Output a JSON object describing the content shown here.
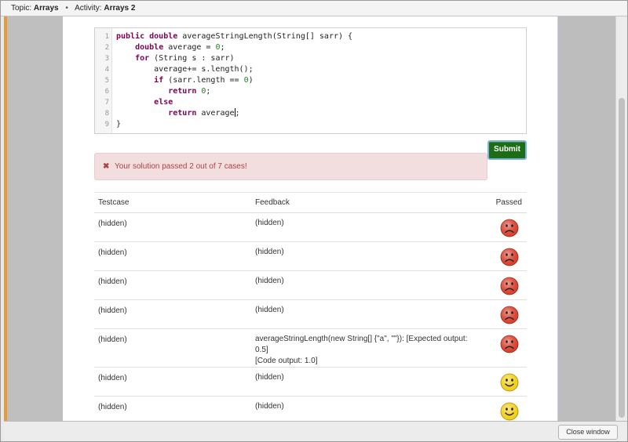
{
  "titlebar": {
    "topic_label": "Topic:",
    "topic_value": "Arrays",
    "separator": "•",
    "activity_label": "Activity:",
    "activity_value": "Arrays 2"
  },
  "editor": {
    "lines": [
      {
        "num": "1",
        "tokens": [
          {
            "t": "public double",
            "c": "kw"
          },
          {
            "t": " averageStringLength(String[] sarr) {",
            "c": ""
          }
        ]
      },
      {
        "num": "2",
        "tokens": [
          {
            "t": "    ",
            "c": ""
          },
          {
            "t": "double",
            "c": "kw"
          },
          {
            "t": " average = ",
            "c": ""
          },
          {
            "t": "0",
            "c": "num"
          },
          {
            "t": ";",
            "c": ""
          }
        ]
      },
      {
        "num": "3",
        "tokens": [
          {
            "t": "    ",
            "c": ""
          },
          {
            "t": "for",
            "c": "kw"
          },
          {
            "t": " (String s : sarr)",
            "c": ""
          }
        ]
      },
      {
        "num": "4",
        "tokens": [
          {
            "t": "        average+= s.length();",
            "c": ""
          }
        ]
      },
      {
        "num": "5",
        "tokens": [
          {
            "t": "        ",
            "c": ""
          },
          {
            "t": "if",
            "c": "kw"
          },
          {
            "t": " (sarr.length == ",
            "c": ""
          },
          {
            "t": "0",
            "c": "num"
          },
          {
            "t": ")",
            "c": ""
          }
        ]
      },
      {
        "num": "6",
        "tokens": [
          {
            "t": "           ",
            "c": ""
          },
          {
            "t": "return",
            "c": "kw"
          },
          {
            "t": " ",
            "c": ""
          },
          {
            "t": "0",
            "c": "num"
          },
          {
            "t": ";",
            "c": ""
          }
        ]
      },
      {
        "num": "7",
        "tokens": [
          {
            "t": "        ",
            "c": ""
          },
          {
            "t": "else",
            "c": "kw"
          }
        ]
      },
      {
        "num": "8",
        "tokens": [
          {
            "t": "           ",
            "c": ""
          },
          {
            "t": "return",
            "c": "kw"
          },
          {
            "t": " average",
            "c": ""
          },
          {
            "t": "",
            "c": "caret"
          },
          {
            "t": ";",
            "c": ""
          }
        ]
      },
      {
        "num": "9",
        "tokens": [
          {
            "t": "}",
            "c": ""
          }
        ]
      }
    ]
  },
  "submit_label": "Submit",
  "alert": {
    "icon": "✖",
    "message": "Your solution passed 2 out of 7 cases!"
  },
  "table": {
    "headers": {
      "testcase": "Testcase",
      "feedback": "Feedback",
      "passed": "Passed"
    },
    "rows": [
      {
        "testcase": "(hidden)",
        "feedback": [
          "(hidden)"
        ],
        "passed": false
      },
      {
        "testcase": "(hidden)",
        "feedback": [
          "(hidden)"
        ],
        "passed": false
      },
      {
        "testcase": "(hidden)",
        "feedback": [
          "(hidden)"
        ],
        "passed": false
      },
      {
        "testcase": "(hidden)",
        "feedback": [
          "(hidden)"
        ],
        "passed": false
      },
      {
        "testcase": "(hidden)",
        "feedback": [
          "averageStringLength(new String[] {\"a\", \"\"}): [Expected output: 0.5]",
          "[Code output: 1.0]"
        ],
        "passed": false
      },
      {
        "testcase": "(hidden)",
        "feedback": [
          "(hidden)"
        ],
        "passed": true
      },
      {
        "testcase": "(hidden)",
        "feedback": [
          "(hidden)"
        ],
        "passed": true
      }
    ]
  },
  "icons": {
    "fail": "sad-face-icon",
    "pass": "smiley-face-icon"
  },
  "colors": {
    "submit_bg": "#1b6d16",
    "alert_bg": "#f2dede",
    "alert_text": "#a94442",
    "fail_face": "#d9412e",
    "pass_face": "#f2cf1b"
  },
  "footer": {
    "close_label": "Close window"
  }
}
